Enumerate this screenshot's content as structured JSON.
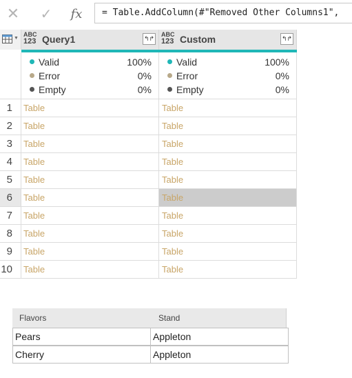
{
  "formula_bar": {
    "cancel_glyph": "✕",
    "confirm_glyph": "✓",
    "fx_label": "fx",
    "formula": "= Table.AddColumn(#\"Removed Other Columns1\","
  },
  "columns": [
    {
      "type_abc": "ABC",
      "type_123": "123",
      "name": "Query1",
      "expand_glyph": "↰↱"
    },
    {
      "type_abc": "ABC",
      "type_123": "123",
      "name": "Custom",
      "expand_glyph": "↰↱"
    }
  ],
  "quality": [
    {
      "valid": {
        "label": "Valid",
        "pct": "100%"
      },
      "error": {
        "label": "Error",
        "pct": "0%"
      },
      "empty": {
        "label": "Empty",
        "pct": "0%"
      }
    },
    {
      "valid": {
        "label": "Valid",
        "pct": "100%"
      },
      "error": {
        "label": "Error",
        "pct": "0%"
      },
      "empty": {
        "label": "Empty",
        "pct": "0%"
      }
    }
  ],
  "quality_colors": {
    "valid": "#1fb7b7",
    "error": "#b8a98a",
    "empty": "#555555"
  },
  "rows": [
    {
      "n": "1",
      "c1": "Table",
      "c2": "Table"
    },
    {
      "n": "2",
      "c1": "Table",
      "c2": "Table"
    },
    {
      "n": "3",
      "c1": "Table",
      "c2": "Table"
    },
    {
      "n": "4",
      "c1": "Table",
      "c2": "Table"
    },
    {
      "n": "5",
      "c1": "Table",
      "c2": "Table"
    },
    {
      "n": "6",
      "c1": "Table",
      "c2": "Table"
    },
    {
      "n": "7",
      "c1": "Table",
      "c2": "Table"
    },
    {
      "n": "8",
      "c1": "Table",
      "c2": "Table"
    },
    {
      "n": "9",
      "c1": "Table",
      "c2": "Table"
    },
    {
      "n": "10",
      "c1": "Table",
      "c2": "Table"
    }
  ],
  "selected_row": "6",
  "preview": {
    "headers": [
      "Flavors",
      "Stand"
    ],
    "rows": [
      [
        "Pears",
        "Appleton"
      ],
      [
        "Cherry",
        "Appleton"
      ]
    ]
  }
}
